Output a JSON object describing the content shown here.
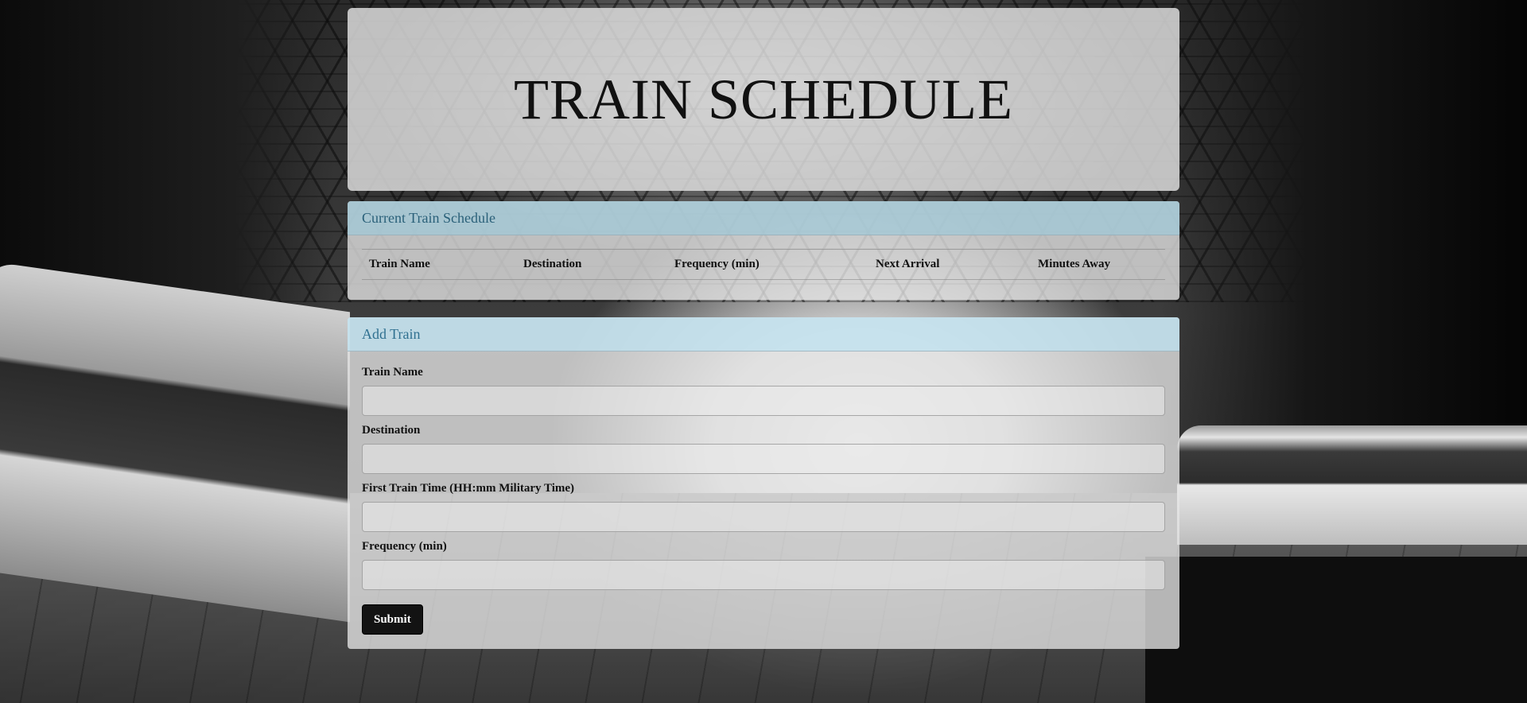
{
  "header": {
    "title": "TRAIN SCHEDULE"
  },
  "schedule": {
    "heading": "Current Train Schedule",
    "columns": [
      "Train Name",
      "Destination",
      "Frequency (min)",
      "Next Arrival",
      "Minutes Away"
    ]
  },
  "add_train": {
    "heading": "Add Train",
    "fields": [
      {
        "label": "Train Name",
        "value": ""
      },
      {
        "label": "Destination",
        "value": ""
      },
      {
        "label": "First Train Time (HH:mm Military Time)",
        "value": ""
      },
      {
        "label": "Frequency (min)",
        "value": ""
      }
    ],
    "submit_label": "Submit"
  }
}
